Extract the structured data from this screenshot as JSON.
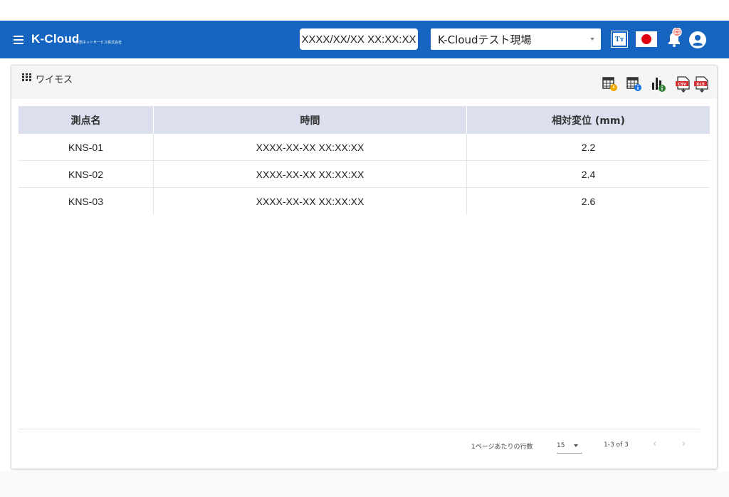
{
  "header": {
    "brand": "K-Cloud",
    "brand_sub": "計測ネットサービス株式会社",
    "datetime": "XXXX/XX/XX XX:XX:XX",
    "site": "K-Cloudテスト現場",
    "bell_badge": "",
    "accent_color": "#1565c0"
  },
  "card": {
    "title": "ワイモス"
  },
  "toolbar": {
    "icons": [
      "table-warning-icon",
      "table-info-icon",
      "bar-chart-info-icon",
      "csv-download-icon",
      "xls-download-icon"
    ],
    "csv_label": "CSV",
    "xls_label": "XLS"
  },
  "table": {
    "columns": [
      "測点名",
      "時間",
      "相対変位 (mm)"
    ],
    "rows": [
      [
        "KNS-01",
        "XXXX-XX-XX XX:XX:XX",
        "2.2"
      ],
      [
        "KNS-02",
        "XXXX-XX-XX XX:XX:XX",
        "2.4"
      ],
      [
        "KNS-03",
        "XXXX-XX-XX XX:XX:XX",
        "2.6"
      ]
    ]
  },
  "pagination": {
    "rows_per_page_label": "1ページあたりの行数",
    "rows_per_page": "15",
    "range": "1-3 of 3",
    "prev": "‹",
    "next": "›"
  }
}
